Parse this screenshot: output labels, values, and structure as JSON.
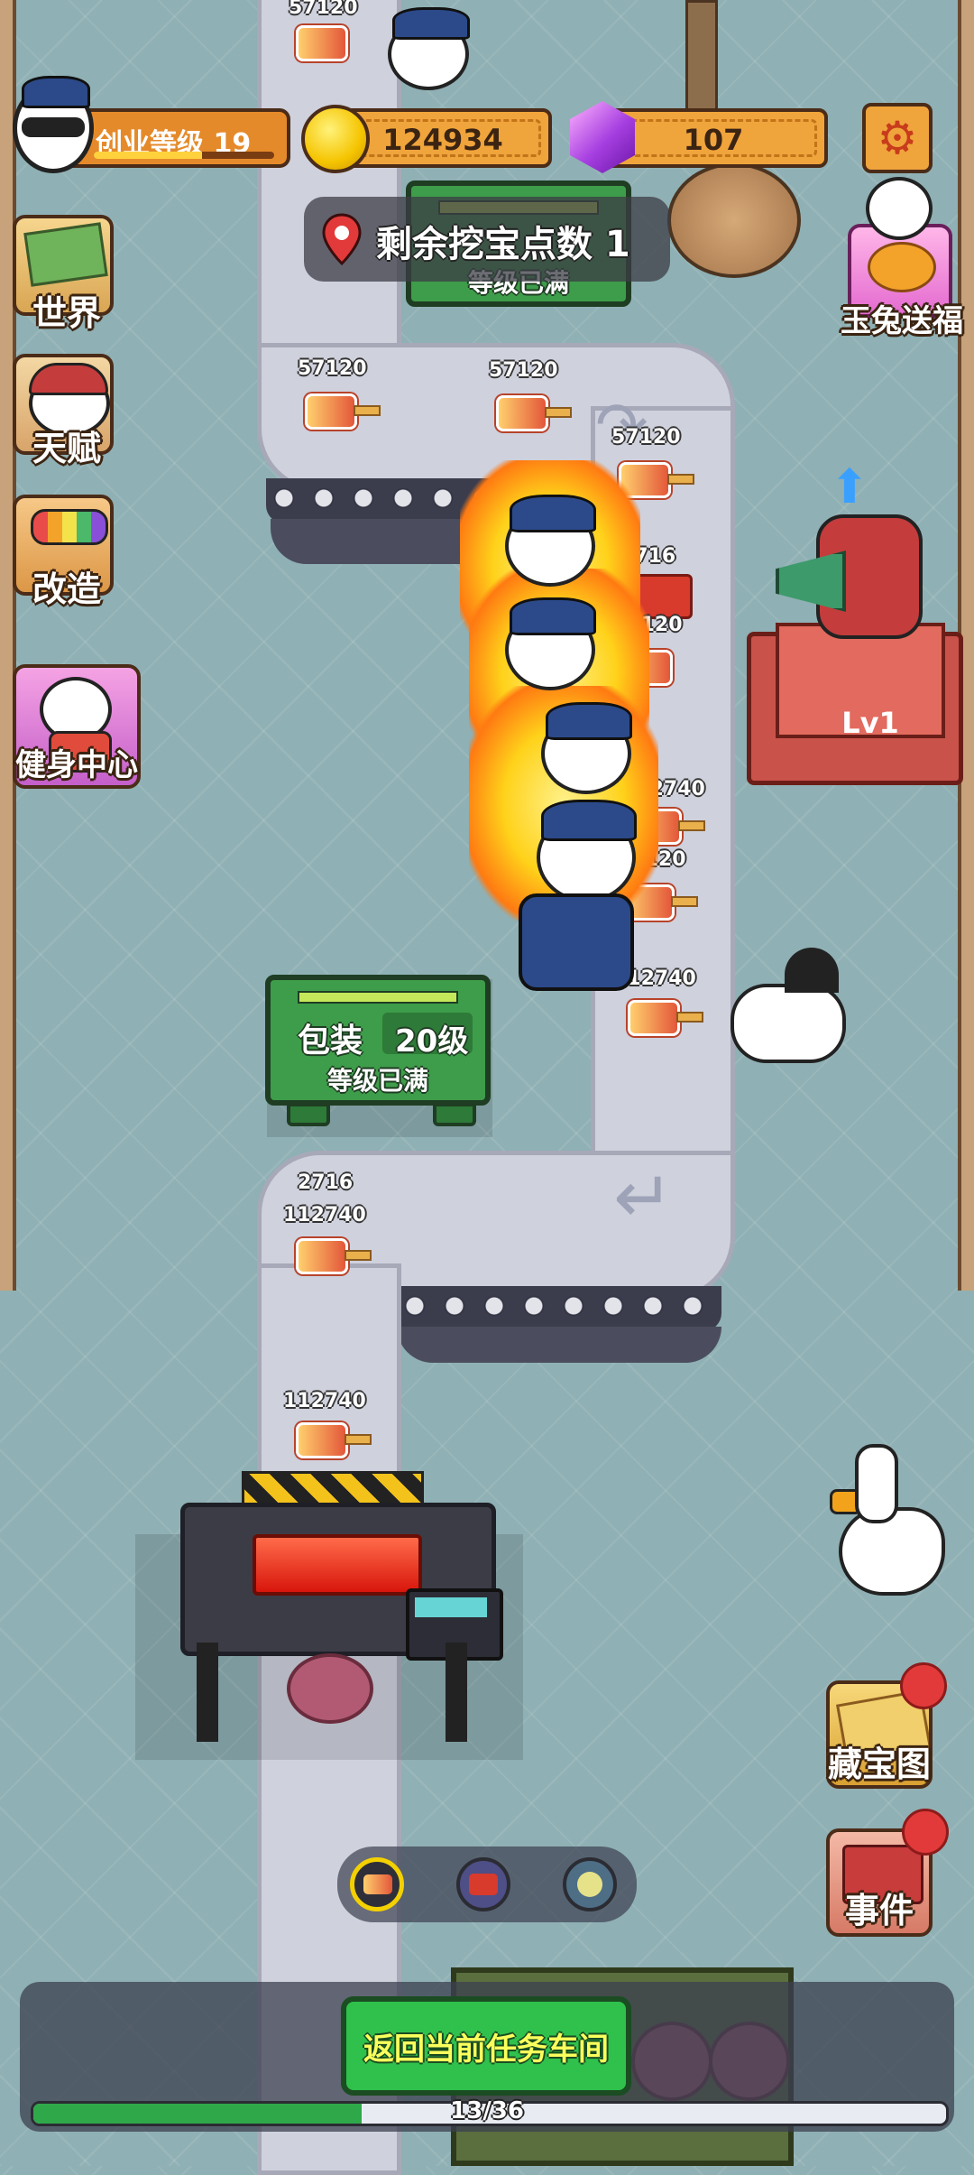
{
  "header": {
    "level_label": "创业等级 19",
    "level_progress": 0.6,
    "coins": "124934",
    "gems": "107"
  },
  "tip": {
    "text": "剩余挖宝点数 1",
    "board_behind": "等级已满"
  },
  "sidebar": {
    "items": [
      {
        "label": "世界",
        "icon": "world-map-icon"
      },
      {
        "label": "天赋",
        "icon": "talent-icon"
      },
      {
        "label": "改造",
        "icon": "paint-roller-icon"
      },
      {
        "label": "健身中心",
        "icon": "gym-icon"
      }
    ]
  },
  "event_promo": {
    "label": "玉兔送福"
  },
  "right_buttons": [
    {
      "label": "藏宝图",
      "icon": "treasure-map-icon"
    },
    {
      "label": "事件",
      "icon": "events-book-icon"
    }
  ],
  "worker": {
    "level": "Lv1"
  },
  "station": {
    "name": "包装",
    "level": "20级",
    "status": "等级已满"
  },
  "item_values": {
    "top_a": "57120",
    "top_b": "57120",
    "top_c": "57120",
    "mid_a": "57120",
    "mid_b": "2716",
    "mid_c": "57120",
    "mid_d": "112740",
    "mid_e": "57120",
    "mid_f": "112740",
    "low_a": "2716",
    "low_b": "112740",
    "low_c": "112740",
    "top_edge": "57120"
  },
  "bottom": {
    "return_button": "返回当前任务车间",
    "progress_text": "13/36",
    "progress_value": 0.36
  },
  "product_selector": [
    "popsicle-icon",
    "candy-icon",
    "dumpling-icon"
  ]
}
